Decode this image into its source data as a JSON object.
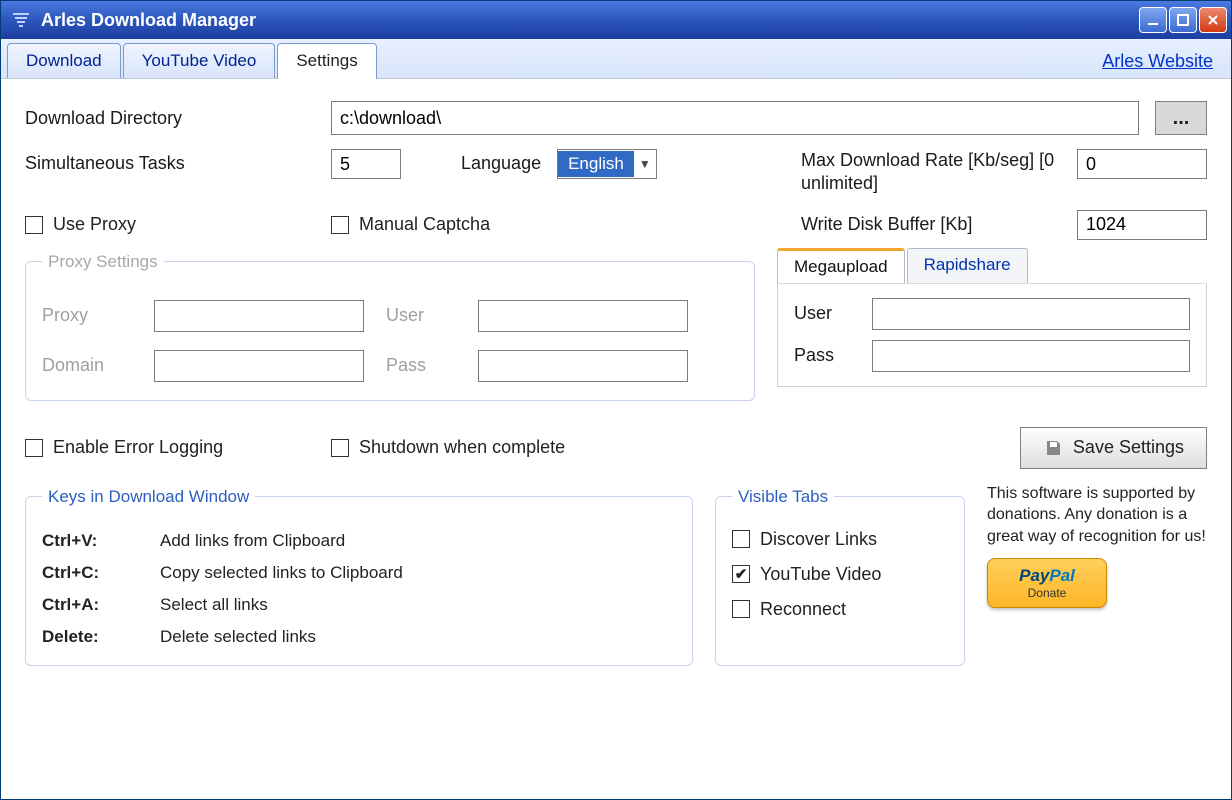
{
  "window": {
    "title": "Arles Download Manager"
  },
  "tabs": {
    "items": [
      {
        "label": "Download"
      },
      {
        "label": "YouTube Video"
      },
      {
        "label": "Settings"
      }
    ],
    "active_index": 2,
    "website_link": "Arles Website"
  },
  "settings": {
    "download_dir_label": "Download Directory",
    "download_dir_value": "c:\\download\\",
    "browse_btn": "...",
    "simultaneous_label": "Simultaneous Tasks",
    "simultaneous_value": "5",
    "language_label": "Language",
    "language_value": "English",
    "max_rate_label": "Max Download Rate [Kb/seg] [0 unlimited]",
    "max_rate_value": "0",
    "use_proxy_label": "Use Proxy",
    "use_proxy_checked": false,
    "manual_captcha_label": "Manual Captcha",
    "manual_captcha_checked": false,
    "write_buffer_label": "Write Disk Buffer [Kb]",
    "write_buffer_value": "1024",
    "proxy_group": {
      "legend": "Proxy Settings",
      "proxy_label": "Proxy",
      "user_label": "User",
      "domain_label": "Domain",
      "pass_label": "Pass"
    },
    "account_tabs": {
      "items": [
        {
          "label": "Megaupload"
        },
        {
          "label": "Rapidshare"
        }
      ],
      "active_index": 0,
      "user_label": "User",
      "pass_label": "Pass",
      "user_value": "",
      "pass_value": ""
    },
    "enable_logging_label": "Enable Error Logging",
    "enable_logging_checked": false,
    "shutdown_label": "Shutdown when complete",
    "shutdown_checked": false,
    "save_btn": "Save Settings",
    "keys_group": {
      "legend": "Keys in Download Window",
      "rows": [
        {
          "k": "Ctrl+V:",
          "d": "Add links from Clipboard"
        },
        {
          "k": "Ctrl+C:",
          "d": "Copy selected links to Clipboard"
        },
        {
          "k": "Ctrl+A:",
          "d": "Select all links"
        },
        {
          "k": "Delete:",
          "d": "Delete selected links"
        }
      ]
    },
    "visible_group": {
      "legend": "Visible Tabs",
      "items": [
        {
          "label": "Discover Links",
          "checked": false
        },
        {
          "label": "YouTube Video",
          "checked": true
        },
        {
          "label": "Reconnect",
          "checked": false
        }
      ]
    },
    "donate": {
      "text": "This software is supported by donations. Any donation is a great way of recognition for us!",
      "brand1": "Pay",
      "brand2": "Pal",
      "sub": "Donate"
    }
  }
}
